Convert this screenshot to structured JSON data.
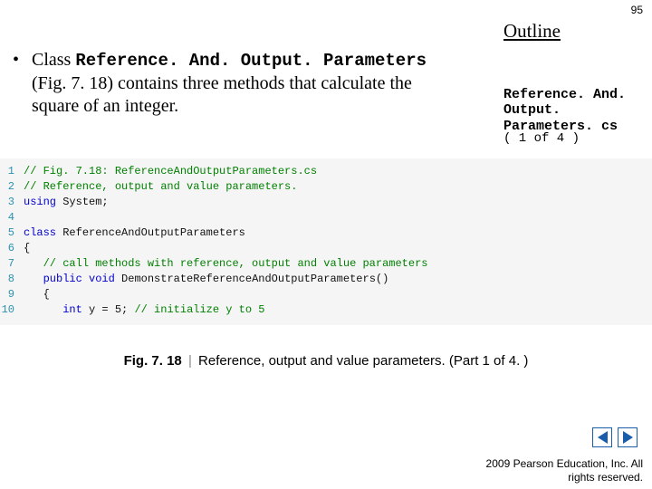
{
  "page_number": "95",
  "outline_label": "Outline",
  "bullet": {
    "prefix": "Class ",
    "classname": "Reference. And. Output. Parameters",
    "rest": " (Fig. 7. 18) contains three methods that calculate the square of an integer."
  },
  "file_label": "Reference. And. Output. Parameters. cs",
  "part_count": "( 1 of 4 )",
  "code_lines": [
    {
      "n": "1",
      "segments": [
        {
          "cls": "c-comment",
          "t": "// Fig. 7.18: ReferenceAndOutputParameters.cs"
        }
      ]
    },
    {
      "n": "2",
      "segments": [
        {
          "cls": "c-comment",
          "t": "// Reference, output and value parameters."
        }
      ]
    },
    {
      "n": "3",
      "segments": [
        {
          "cls": "c-keyword",
          "t": "using"
        },
        {
          "cls": "c-text",
          "t": " System;"
        }
      ]
    },
    {
      "n": "4",
      "segments": []
    },
    {
      "n": "5",
      "segments": [
        {
          "cls": "c-keyword",
          "t": "class"
        },
        {
          "cls": "c-text",
          "t": " ReferenceAndOutputParameters"
        }
      ]
    },
    {
      "n": "6",
      "segments": [
        {
          "cls": "c-text",
          "t": "{"
        }
      ]
    },
    {
      "n": "7",
      "segments": [
        {
          "cls": "c-text",
          "t": "   "
        },
        {
          "cls": "c-comment",
          "t": "// call methods with reference, output and value parameters"
        }
      ]
    },
    {
      "n": "8",
      "segments": [
        {
          "cls": "c-text",
          "t": "   "
        },
        {
          "cls": "c-keyword",
          "t": "public"
        },
        {
          "cls": "c-text",
          "t": " "
        },
        {
          "cls": "c-keyword",
          "t": "void"
        },
        {
          "cls": "c-text",
          "t": " DemonstrateReferenceAndOutputParameters()"
        }
      ]
    },
    {
      "n": "9",
      "segments": [
        {
          "cls": "c-text",
          "t": "   {"
        }
      ]
    },
    {
      "n": "10",
      "segments": [
        {
          "cls": "c-text",
          "t": "      "
        },
        {
          "cls": "c-keyword",
          "t": "int"
        },
        {
          "cls": "c-text",
          "t": " y = "
        },
        {
          "cls": "c-number",
          "t": "5"
        },
        {
          "cls": "c-text",
          "t": "; "
        },
        {
          "cls": "c-comment",
          "t": "// initialize y to 5"
        }
      ]
    }
  ],
  "caption": {
    "figno": "Fig. 7. 18",
    "pipe": "|",
    "text": "Reference, output and value parameters. (Part 1 of 4. )"
  },
  "nav": {
    "prev": "prev-slide",
    "next": "next-slide"
  },
  "copyright": "  2009 Pearson Education, Inc.  All rights reserved."
}
